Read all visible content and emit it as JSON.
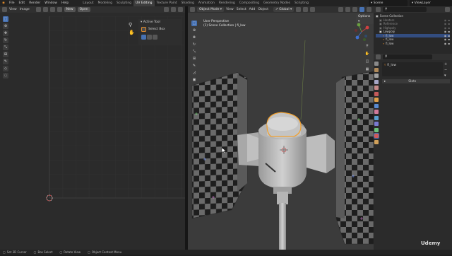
{
  "topbar": {
    "menus": [
      "File",
      "Edit",
      "Render",
      "Window",
      "Help"
    ],
    "workspaces": [
      "Layout",
      "Modeling",
      "Sculpting",
      "UV Editing",
      "Texture Paint",
      "Shading",
      "Animation",
      "Rendering",
      "Compositing",
      "Geometry Nodes",
      "Scripting"
    ],
    "active_workspace": "UV Editing",
    "scene": "Scene",
    "view_layer": "ViewLayer"
  },
  "uv_editor": {
    "header_menus": [
      "View",
      "Image"
    ],
    "new_button": "New",
    "open_button": "Open",
    "active_tool_label": "Active Tool",
    "select_box_label": "Select Box"
  },
  "viewport": {
    "mode": "Object Mode",
    "menus": [
      "View",
      "Select",
      "Add",
      "Object"
    ],
    "orientation": "Global",
    "options": "Options",
    "perspective": "User Perspective",
    "collection_path": "(1) Scene Collection | fi_low"
  },
  "outliner": {
    "title": "Scene Collection",
    "items": [
      {
        "label": "Heaters",
        "dim": true
      },
      {
        "label": "Reference",
        "dim": true
      },
      {
        "label": "Highpoly",
        "dim": true
      },
      {
        "label": "Lowpoly",
        "dim": false
      },
      {
        "label": "fi_low",
        "dim": false
      },
      {
        "label": "fi_low",
        "dim": false
      },
      {
        "label": "fi_low",
        "dim": false
      }
    ]
  },
  "properties": {
    "object_name": "fi_low",
    "panel_label": "Slots"
  },
  "statusbar": {
    "items": [
      "Set 3D Cursor",
      "Box Select",
      "Rotate View",
      "Object Context Menu"
    ]
  },
  "watermark": "Udemy",
  "colors": {
    "accent": "#4772b3",
    "selection_outline": "#f0a030",
    "model": "#c8c8c8",
    "checker_dark": "#1e1e1e",
    "checker_light": "#6a6a6a"
  }
}
